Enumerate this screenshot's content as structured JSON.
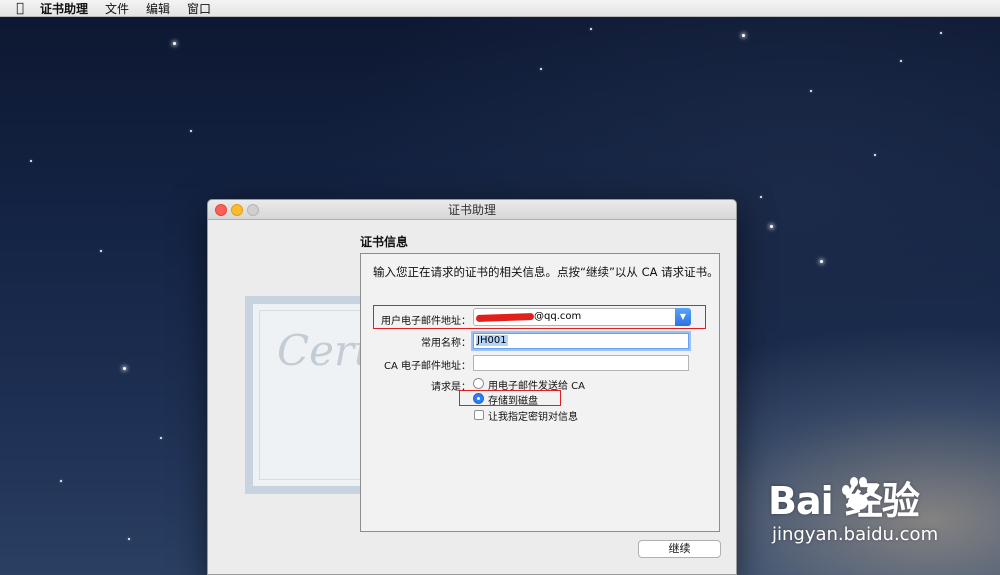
{
  "menubar": {
    "apple_icon": "",
    "app_name": "证书助理",
    "items": [
      "文件",
      "编辑",
      "窗口"
    ]
  },
  "window": {
    "title": "证书助理",
    "background_watermark": "Certific",
    "section_title": "证书信息",
    "intro": "输入您正在请求的证书的相关信息。点按“继续”以从 CA 请求证书。",
    "fields": {
      "email_label": "用户电子邮件地址：",
      "email_value": "@qq.com",
      "common_name_label": "常用名称：",
      "common_name_value": "JH001",
      "ca_email_label": "CA 电子邮件地址：",
      "ca_email_value": ""
    },
    "request": {
      "label": "请求是：",
      "options": [
        "用电子邮件发送给 CA",
        "存储到磁盘"
      ],
      "selected_index": 1,
      "checkbox_label": "让我指定密钥对信息",
      "checkbox_checked": false
    },
    "continue_button": "继续"
  },
  "watermark": {
    "brand": "Bai  经验",
    "url": "jingyan.baidu.com"
  },
  "colors": {
    "accent": "#2f7ff0",
    "highlight_box": "#e02020"
  }
}
